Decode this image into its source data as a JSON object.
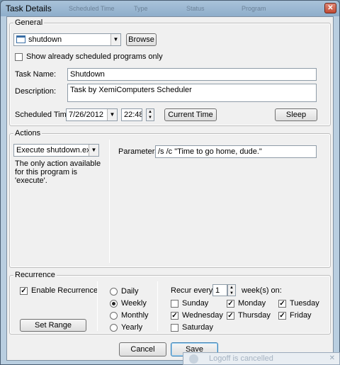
{
  "window": {
    "title": "Task Details",
    "background_columns": [
      "Scheduled Time",
      "Type",
      "Status",
      "Program"
    ]
  },
  "general": {
    "legend": "General",
    "program": {
      "value": "shutdown",
      "browse_label": "Browse"
    },
    "show_scheduled_only": {
      "label": "Show already scheduled programs only",
      "checked": false
    },
    "task_name": {
      "label": "Task Name:",
      "value": "Shutdown"
    },
    "description": {
      "label": "Description:",
      "value": "Task by XemiComputers Scheduler"
    },
    "scheduled_time": {
      "label": "Scheduled Time:",
      "date": "7/26/2012",
      "time": "22:48",
      "current_time_label": "Current Time",
      "sleep_label": "Sleep"
    }
  },
  "actions": {
    "legend": "Actions",
    "action": {
      "value": "Execute shutdown.exe"
    },
    "note": "The only action available for this program is 'execute'.",
    "parameters": {
      "label": "Parameters:",
      "value": "/s /c \"Time to go home, dude.\""
    }
  },
  "recurrence": {
    "legend": "Recurrence",
    "enable": {
      "label": "Enable Recurrence",
      "checked": true
    },
    "set_range_label": "Set Range",
    "options": [
      {
        "label": "Daily",
        "selected": false
      },
      {
        "label": "Weekly",
        "selected": true
      },
      {
        "label": "Monthly",
        "selected": false
      },
      {
        "label": "Yearly",
        "selected": false
      }
    ],
    "recur_every_label": "Recur every",
    "recur_value": "1",
    "weeks_on_label": "week(s) on:",
    "days": [
      {
        "label": "Sunday",
        "checked": false
      },
      {
        "label": "Monday",
        "checked": true
      },
      {
        "label": "Tuesday",
        "checked": true
      },
      {
        "label": "Wednesday",
        "checked": true
      },
      {
        "label": "Thursday",
        "checked": true
      },
      {
        "label": "Friday",
        "checked": true
      },
      {
        "label": "Saturday",
        "checked": false
      }
    ]
  },
  "buttons": {
    "cancel_label": "Cancel",
    "save_label": "Save"
  },
  "notification": {
    "text": "Logoff is cancelled"
  }
}
